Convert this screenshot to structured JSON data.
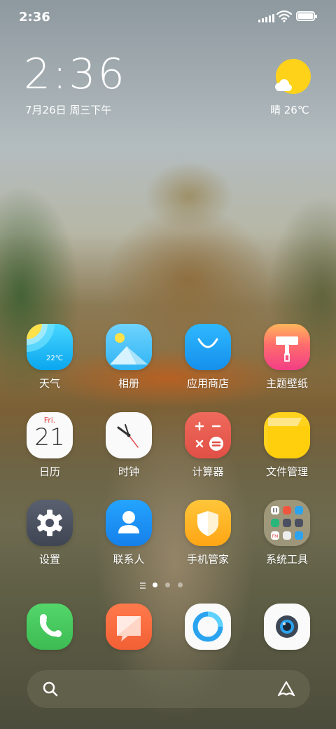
{
  "status_bar": {
    "time": "2:36"
  },
  "clock_widget": {
    "time": "2:36",
    "date": "7月26日 周三下午"
  },
  "weather_widget": {
    "text": "晴 26℃"
  },
  "apps": [
    {
      "label": "天气",
      "icon_text": "22℃"
    },
    {
      "label": "相册"
    },
    {
      "label": "应用商店"
    },
    {
      "label": "主题壁纸"
    },
    {
      "label": "日历",
      "icon_day": "Fri.",
      "icon_date": "21"
    },
    {
      "label": "时钟"
    },
    {
      "label": "计算器"
    },
    {
      "label": "文件管理"
    },
    {
      "label": "设置"
    },
    {
      "label": "联系人"
    },
    {
      "label": "手机管家"
    },
    {
      "label": "系统工具",
      "folder_badge": "FM"
    }
  ],
  "page_indicator": {
    "pages": 3,
    "active": 1
  },
  "dock": [
    "phone-icon",
    "messages-icon",
    "browser-icon",
    "camera-icon"
  ],
  "search_bar": {
    "icons": [
      "search-icon",
      "assistant-icon"
    ]
  },
  "colors": {
    "weather": "#1ab8f5",
    "gallery": "#4ec3f5",
    "store": "#1ba0f2",
    "themes": "#f0477d",
    "calculator": "#e85a4f",
    "files": "#ffd21e",
    "settings": "#4a5061",
    "contacts": "#1d8cf0",
    "security": "#ffb81e",
    "phone": "#47c95e",
    "messages": "#ff6a3d"
  }
}
